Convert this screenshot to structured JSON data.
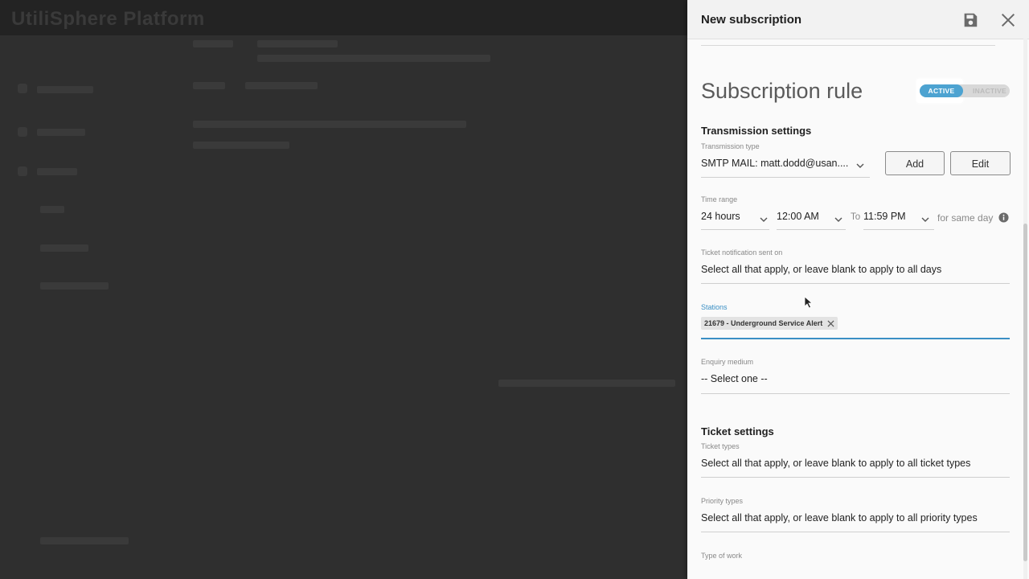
{
  "background": {
    "brand": "UtiliSphere Platform"
  },
  "panel": {
    "title": "New subscription",
    "rule_title": "Subscription rule",
    "toggle": {
      "active_label": "ACTIVE",
      "inactive_label": "INACTIVE",
      "state": "active"
    },
    "transmission": {
      "section": "Transmission settings",
      "type_label": "Transmission type",
      "type_value": "SMTP MAIL: matt.dodd@usan....",
      "add_label": "Add",
      "edit_label": "Edit"
    },
    "time_range": {
      "label": "Time range",
      "range_value": "24 hours",
      "start": "12:00 AM",
      "to_label": "To",
      "end": "11:59 PM",
      "suffix": "for same day"
    },
    "ticket_notification": {
      "label": "Ticket notification sent on",
      "placeholder": "Select all that apply, or leave blank to apply to all days"
    },
    "stations": {
      "label": "Stations",
      "chips": [
        "21679 - Underground Service Alert"
      ]
    },
    "enquiry": {
      "label": "Enquiry medium",
      "value": "-- Select one --"
    },
    "ticket_settings": {
      "section": "Ticket settings",
      "ticket_types_label": "Ticket types",
      "ticket_types_placeholder": "Select all that apply, or leave blank to apply to all ticket types",
      "priority_types_label": "Priority types",
      "priority_types_placeholder": "Select all that apply, or leave blank to apply to all priority types",
      "type_of_work_label": "Type of work"
    }
  },
  "colors": {
    "accent": "#4da3d1",
    "stations_focus": "#3a8fc4",
    "overlay": "#2f2f2f"
  },
  "icons": [
    "save-icon",
    "close-icon",
    "chevron-down-icon",
    "info-icon",
    "chip-remove-icon",
    "mouse-cursor-icon"
  ]
}
